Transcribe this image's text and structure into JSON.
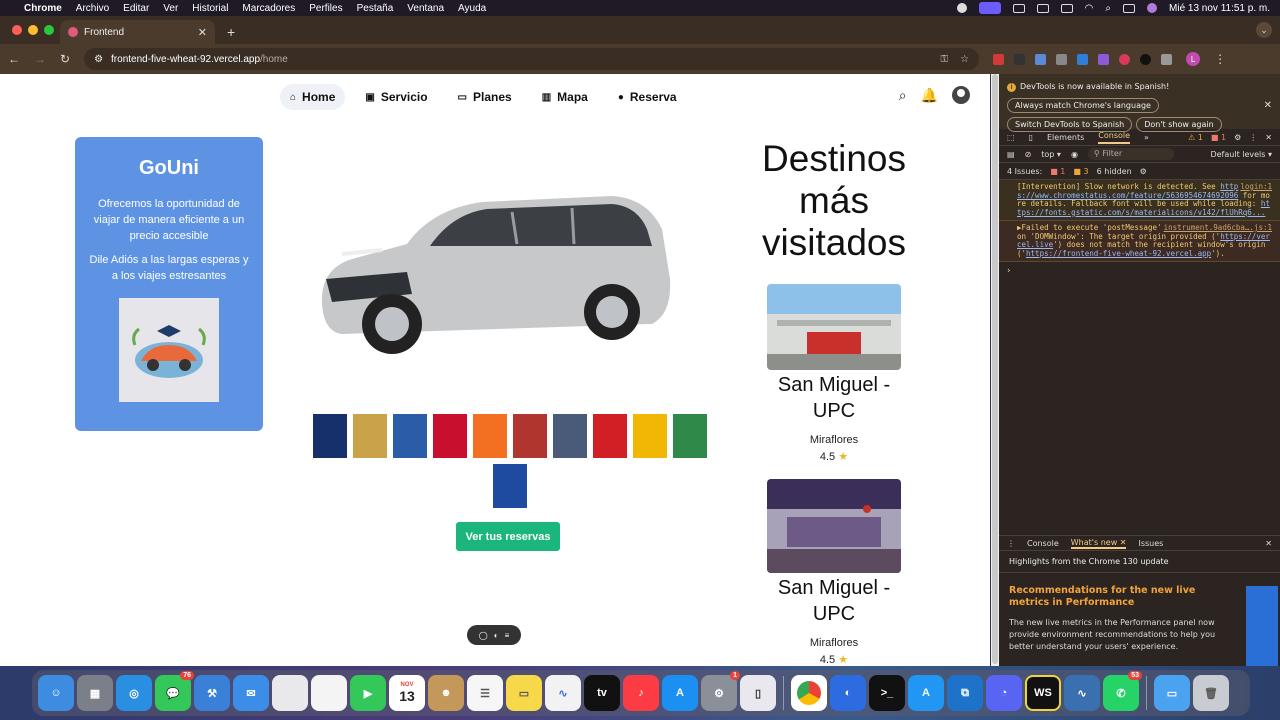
{
  "menubar": {
    "app": "Chrome",
    "items": [
      "Archivo",
      "Editar",
      "Ver",
      "Historial",
      "Marcadores",
      "Perfiles",
      "Pestaña",
      "Ventana",
      "Ayuda"
    ],
    "datetime": "Mié 13 nov 11:51 p. m."
  },
  "browser": {
    "tab_title": "Frontend",
    "url_host": "frontend-five-wheat-92.vercel.app",
    "url_path": "/home",
    "profile_initial": "L"
  },
  "nav": {
    "items": [
      {
        "label": "Home",
        "icon": "home-icon"
      },
      {
        "label": "Servicio",
        "icon": "car-icon"
      },
      {
        "label": "Planes",
        "icon": "monitor-icon"
      },
      {
        "label": "Mapa",
        "icon": "map-icon"
      },
      {
        "label": "Reserva",
        "icon": "user-icon"
      }
    ]
  },
  "card": {
    "title": "GoUni",
    "text1": "Ofrecemos la oportunidad de viajar de manera eficiente a un precio accesible",
    "text2": "Dile Adiós a las largas esperas y a los viajes estresantes"
  },
  "universities": [
    {
      "color": "#16306b"
    },
    {
      "color": "#c9a24a"
    },
    {
      "color": "#2a5ca8"
    },
    {
      "color": "#c8102e"
    },
    {
      "color": "#f36f21"
    },
    {
      "color": "#b0352e"
    },
    {
      "color": "#4a5b7a"
    },
    {
      "color": "#d21f26"
    },
    {
      "color": "#f2b705"
    },
    {
      "color": "#2f8a4a"
    },
    {
      "color": "#1e4aa0"
    }
  ],
  "reservas_button": "Ver tus reservas",
  "destinos": {
    "title": "Destinos más visitados",
    "items": [
      {
        "name": "San Miguel - UPC",
        "city": "Miraflores",
        "rating": "4.5",
        "star": "★"
      },
      {
        "name": "San Miguel - UPC",
        "city": "Miraflores",
        "rating": "4.5",
        "star": "★"
      }
    ]
  },
  "devtools": {
    "banner": "DevTools is now available in Spanish!",
    "btn_match": "Always match Chrome's language",
    "btn_switch": "Switch DevTools to Spanish",
    "btn_dont": "Don't show again",
    "tab_elements": "Elements",
    "tab_console": "Console",
    "warn_count": "1",
    "err_count": "1",
    "context": "top",
    "filter_placeholder": "Filter",
    "levels": "Default levels",
    "issues_label": "4 Issues:",
    "issues_err": "1",
    "issues_warn": "3",
    "hidden": "6 hidden",
    "log1": {
      "src": "login:1",
      "text_a": "[Intervention] Slow network is detected. See ",
      "link_a": "https://www.chromestatus.com/feature/5636954674692096",
      "text_b": " for more details. Fallback font will be used while loading: ",
      "link_b": "https://fonts.gstatic.com/s/materialicons/v142/flUhRq6..."
    },
    "log2": {
      "src": "instrument.9ad6cba….js:1",
      "text_a": "▶Failed to execute 'postMessage' on 'DOMWindow': The target origin provided ('",
      "link_a": "https://vercel.live",
      "text_b": "') does not match the recipient window's origin ('",
      "link_b": "https://frontend-five-wheat-92.vercel.app",
      "text_c": "')."
    },
    "drawer_console": "Console",
    "drawer_whatsnew": "What's new",
    "drawer_issues": "Issues",
    "highlights": "Highlights from the Chrome 130 update",
    "rec_title": "Recommendations for the new live metrics in Performance",
    "rec_text": "The new live metrics in the Performance panel now provide environment recommendations to help you better understand your users' experience."
  },
  "dock": {
    "messages_badge": "76",
    "calendar_month": "NOV",
    "calendar_day": "13",
    "settings_badge": "1",
    "whatsapp_badge": "53",
    "ws_label": "WS"
  }
}
